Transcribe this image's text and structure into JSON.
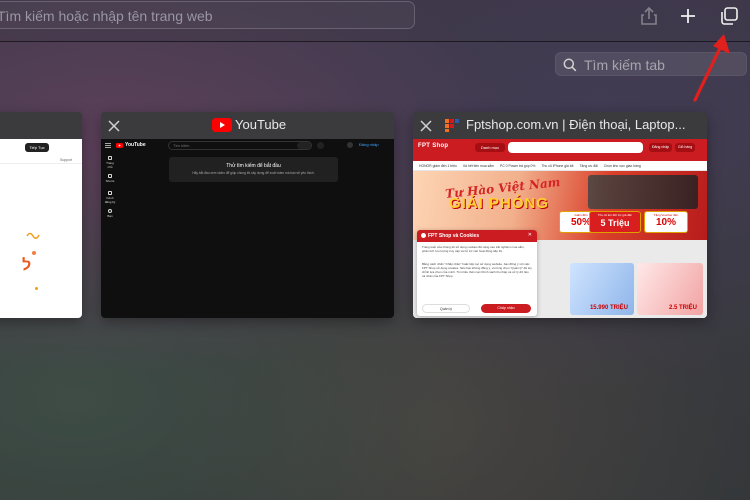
{
  "toolbar": {
    "address_placeholder": "Tìm kiếm hoặc nhập tên trang web",
    "share_icon": "share-icon",
    "new_tab_icon": "plus-icon",
    "tab_overview_icon": "tab-overview-icon"
  },
  "tab_search": {
    "placeholder": "Tìm kiếm tab",
    "icon": "magnifier-icon"
  },
  "annotation": {
    "color": "#e0201c"
  },
  "tabs": [
    {
      "title": "",
      "button": "Tiếp Tục",
      "links": [
        "Support"
      ],
      "glyph": "ל"
    },
    {
      "title": "YouTube",
      "logo_text": "YouTube",
      "search_placeholder": "Tìm kiếm",
      "signin": "Đăng nhập",
      "empty_title": "Thử tìm kiếm để bắt đầu",
      "empty_text": "Hãy bắt đầu xem video để giúp chúng tôi xây dựng để xuất video mà bạn sẽ yêu thích.",
      "side_items": [
        "Trang chủ",
        "Shorts",
        "Kênh đăng ký",
        "Bạn"
      ]
    },
    {
      "title": "Fptshop.com.vn | Điện thoại, Laptop...",
      "logo_text": "FPT Shop",
      "menu_label": "Danh mục",
      "header_buttons": [
        "Đăng nhập",
        "Giỏ hàng"
      ],
      "quick_links": [
        "HONOR giảm đến 1 triệu",
        "Xả hết tiền mua sắm",
        "PC 0 Power trả góp 0%",
        "Thu cũ iPhone giá tốt",
        "Tặng ưu đãi",
        "Chọn khu vực giao hàng"
      ],
      "slogan_line1": "Tự Hào Việt Nam",
      "slogan_line2": "GIẢI PHÓNG",
      "promos": [
        {
          "label": "Giảm đến",
          "value": "50%"
        },
        {
          "label": "Thu cũ lên đời trợ giá đến",
          "value": "5 Triệu"
        },
        {
          "label": "Tặng Voucher đến",
          "value": "10%"
        }
      ],
      "ad_prices": [
        "15.990 TRIỆU",
        "2.5 TRIỆU"
      ],
      "cookie_title": "FPT Shop và Cookies",
      "cookie_text1": "Trang web của chúng tôi sử dụng cookies để nâng cao trải nghiệm mua sắm, phân tích lưu lượng truy cập và hỗ trợ các hoạt động tiếp thị.",
      "cookie_text2": "Bằng cách nhấn \"Chấp nhận\" hoặc tiếp tục sử dụng website, bạn đồng ý với việc FPT Shop sử dụng cookies. Nếu bạn không đồng ý, vui lòng chọn \"Quản lý\" để tùy chỉnh lựa chọn của mình. Tìm hiểu thêm tại Chính sách thu thập và xử lý dữ liệu cá nhân của FPT Shop.",
      "cookie_manage": "Quản lý",
      "cookie_accept": "Chấp nhận"
    }
  ]
}
